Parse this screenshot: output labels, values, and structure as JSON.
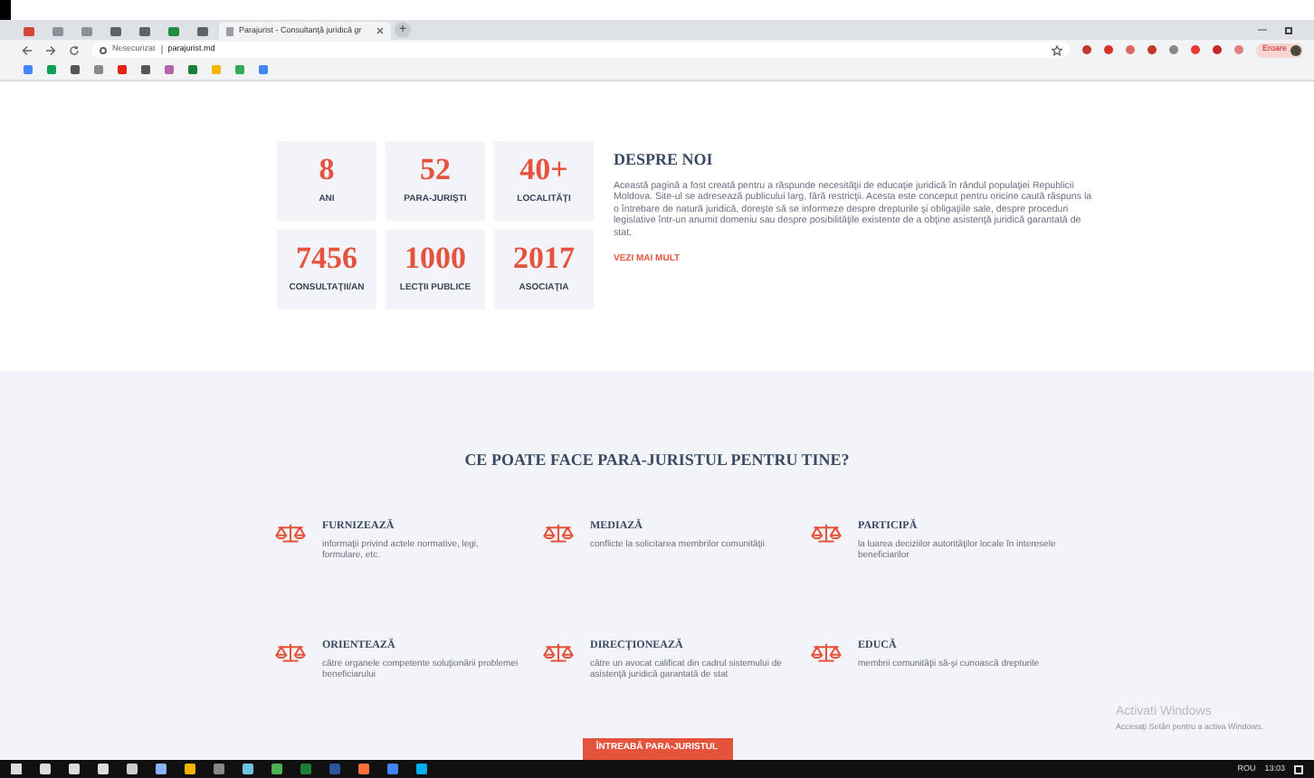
{
  "browser": {
    "pinned_tabs": [
      {
        "color": "#d44638"
      },
      {
        "color": "#8a8f98"
      },
      {
        "color": "#8a8f98"
      },
      {
        "color": "#5f6368"
      },
      {
        "color": "#5f6368"
      },
      {
        "color": "#1e8e3e"
      },
      {
        "color": "#5f6368"
      }
    ],
    "active_tab": {
      "title": "Parajurist - Consultanţă juridică gr",
      "selected": true
    },
    "new_tab": "+",
    "address": {
      "security": "Nesecurizat",
      "url": "parajurist.md"
    },
    "profile": "Eroare"
  },
  "stats": [
    {
      "value": "8",
      "label": "ANI"
    },
    {
      "value": "52",
      "label": "PARA-JURIŞTI"
    },
    {
      "value": "40+",
      "label": "LOCALITĂŢI"
    },
    {
      "value": "7456",
      "label": "CONSULTAŢII/AN"
    },
    {
      "value": "1000",
      "label": "LECŢII PUBLICE"
    },
    {
      "value": "2017",
      "label": "ASOCIAŢIA"
    }
  ],
  "about": {
    "title": "DESPRE NOI",
    "text": "Această pagină a fost creată pentru a răspunde necesităţii de educaţie juridică în rândul populaţiei Republicii Moldova. Site-ul se adresează publicului larg, fără restricţii. Acesta este conceput pentru oricine caută răspuns la o întrebare de natură juridică, doreşte să se informeze despre drepturile şi obligaţiile sale, despre proceduri legislative într-un anumit domeniu sau despre posibilităţile existente de a obţine asistenţă juridică garantată de stat.",
    "link": "VEZI MAI MULT"
  },
  "features": {
    "title": "CE POATE FACE PARA-JURISTUL PENTRU TINE?",
    "items": [
      {
        "title": "FURNIZEAZĂ",
        "text": "informaţii privind actele normative, legi, formulare, etc."
      },
      {
        "title": "MEDIAZĂ",
        "text": "conflicte la solicitarea membrilor comunităţii"
      },
      {
        "title": "PARTICIPĂ",
        "text": "la luarea deciziilor autorităţilor locale în interesele beneficiarilor"
      },
      {
        "title": "ORIENTEAZĂ",
        "text": "către organele competente soluţionării problemei beneficiarului"
      },
      {
        "title": "DIRECŢIONEAZĂ",
        "text": "către un avocat calificat din cadrul sistemului de asistenţă juridică garantată de stat"
      },
      {
        "title": "EDUCĂ",
        "text": "membrii comunităţii să-şi cunoască drepturile"
      }
    ]
  },
  "cta": "ÎNTREABĂ PARA-JURISTUL",
  "activation": {
    "title": "Activati Windows",
    "text": "Accesaţi Setări pentru a activa Windows."
  },
  "taskbar": {
    "language": "ROU",
    "clock": "13:03"
  }
}
